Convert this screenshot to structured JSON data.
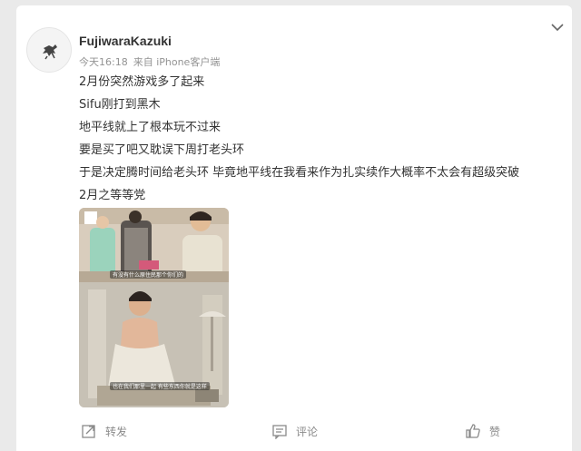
{
  "post": {
    "username": "FujiwaraKazuki",
    "time": "今天16:18",
    "source": "来自 iPhone客户端",
    "lines": [
      "2月份突然游戏多了起来",
      "Sifu刚打到黑木",
      "地平线就上了根本玩不过来",
      "要是买了吧又耽误下周打老头环",
      "于是决定腾时间给老头环 毕竟地平线在我看来作为扎实续作大概率不太会有超级突破",
      "2月之等等党"
    ]
  },
  "image": {
    "top_caption": "有没有什么原住民那个你们的",
    "bottom_caption": "也在我们那里一起 有些东西你就是这样"
  },
  "actions": {
    "repost": "转发",
    "comment": "评论",
    "like": "赞"
  },
  "icons": {
    "menu": "chevron-down-icon",
    "repost": "repost-icon",
    "comment": "comment-icon",
    "like": "thumbs-up-icon"
  }
}
